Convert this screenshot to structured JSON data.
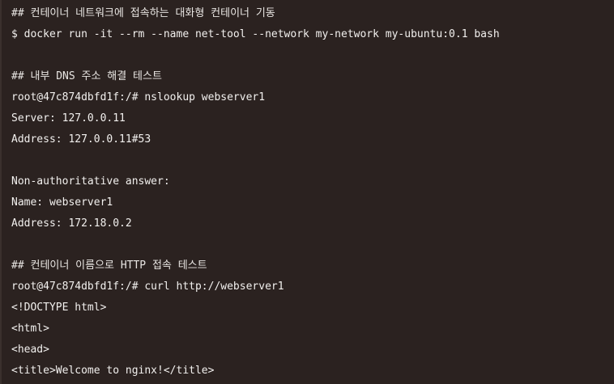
{
  "terminal": {
    "lines": [
      {
        "type": "comment",
        "text": "## 컨테이너 네트워크에 접속하는 대화형 컨테이너 기동"
      },
      {
        "type": "command",
        "text": "$ docker run -it --rm --name net-tool --network my-network my-ubuntu:0.1 bash"
      },
      {
        "type": "blank",
        "text": ""
      },
      {
        "type": "comment",
        "text": "## 내부 DNS 주소 해결 테스트"
      },
      {
        "type": "command",
        "text": "root@47c874dbfd1f:/# nslookup webserver1"
      },
      {
        "type": "output",
        "text": "Server: 127.0.0.11"
      },
      {
        "type": "output",
        "text": "Address: 127.0.0.11#53"
      },
      {
        "type": "blank",
        "text": ""
      },
      {
        "type": "output",
        "text": "Non-authoritative answer:"
      },
      {
        "type": "output",
        "text": "Name: webserver1"
      },
      {
        "type": "output",
        "text": "Address: 172.18.0.2"
      },
      {
        "type": "blank",
        "text": ""
      },
      {
        "type": "comment",
        "text": "## 컨테이너 이름으로 HTTP 접속 테스트"
      },
      {
        "type": "command",
        "text": "root@47c874dbfd1f:/# curl http://webserver1"
      },
      {
        "type": "output",
        "text": "<!DOCTYPE html>"
      },
      {
        "type": "output",
        "text": "<html>"
      },
      {
        "type": "output",
        "text": "<head>"
      },
      {
        "type": "output",
        "text": "<title>Welcome to nginx!</title>"
      }
    ]
  }
}
